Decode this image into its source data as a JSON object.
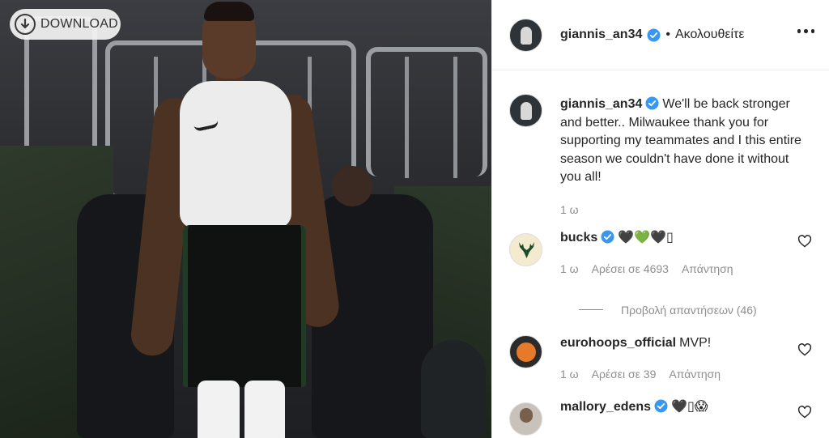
{
  "photo": {
    "download_label": "DOWNLOAD"
  },
  "header": {
    "username": "giannis_an34",
    "separator": "•",
    "follow_label": "Ακολουθείτε"
  },
  "caption": {
    "username": "giannis_an34",
    "text": "We'll be back stronger and better.. Milwaukee thank you for supporting my teammates and I this entire season we couldn't have done it without you all!",
    "time": "1 ω"
  },
  "comments": [
    {
      "username": "bucks",
      "text": "🖤💚🖤▯",
      "time": "1 ω",
      "likes": "Αρέσει σε 4693",
      "reply": "Απάντηση",
      "view_replies": "Προβολή απαντήσεων (46)"
    },
    {
      "username": "eurohoops_official",
      "text": "MVP!",
      "time": "1 ω",
      "likes": "Αρέσει σε 39",
      "reply": "Απάντηση"
    },
    {
      "username": "mallory_edens",
      "text": "🖤▯😱"
    }
  ],
  "colors": {
    "verified": "#3897f0",
    "muted_text": "#8e8e8e",
    "primary_text": "#262626"
  }
}
